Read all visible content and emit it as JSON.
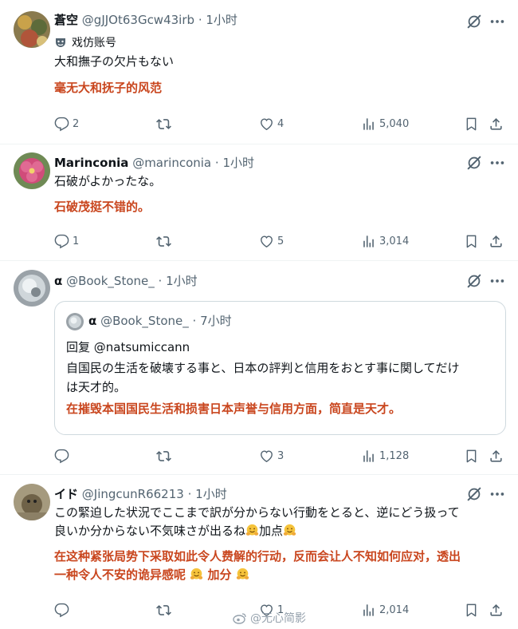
{
  "icons": {
    "grok": "grok-slash-icon",
    "more": "more-horizontal-icon",
    "reply": "reply-bubble-icon",
    "repost": "repost-icon",
    "like": "heart-icon",
    "views": "views-bar-icon",
    "bookmark": "bookmark-icon",
    "share": "share-icon",
    "label": "parody-mask-icon",
    "weibo": "weibo-icon",
    "emoji": "hugging-face-emoji"
  },
  "colors": {
    "translation": "#c9461e",
    "meta": "#536471",
    "divider": "#eff3f4"
  },
  "posts": [
    {
      "name": "蒼空",
      "handle": "@gJJOt63Gcw43irb",
      "time": "· 1小时",
      "label": "戏仿账号",
      "text": "大和撫子の欠片もない",
      "translation": "毫无大和抚子的风范",
      "replies": "2",
      "likes": "4",
      "views": "5,040"
    },
    {
      "name": "Marinconia",
      "handle": "@marinconia",
      "time": "· 1小时",
      "text": "石破がよかったな。",
      "translation": "石破茂挺不错的。",
      "replies": "1",
      "likes": "5",
      "views": "3,014"
    },
    {
      "name": "α",
      "handle": "@Book_Stone_",
      "time": "· 1小时",
      "quote": {
        "name": "α",
        "handle": "@Book_Stone_",
        "time": "· 7小时",
        "reply_to": "回复 @natsumiccann",
        "line1": "自国民の生活を破壊する事と、日本の評判と信用をおとす事に関してだけ",
        "line2": "は天才的。",
        "translation": "在摧毁本国国民生活和损害日本声誉与信用方面，简直是天才。"
      },
      "likes": "3",
      "views": "1,128"
    },
    {
      "name": "イド",
      "handle": "@JingcunR66213",
      "time": "· 1小时",
      "line1": "この緊迫した状況でここまで訳が分からない行動をとると、逆にどう扱って",
      "line2a": "良いか分からない不気味さが出るね",
      "line2b": "加点",
      "trans1": "在这种紧张局势下采取如此令人费解的行动，反而会让人不知如何应对，透出",
      "trans2a": "一种令人不安的诡异感呢",
      "trans2b": "加分",
      "likes": "1",
      "views": "2,014"
    }
  ],
  "watermark": "@无心简影"
}
